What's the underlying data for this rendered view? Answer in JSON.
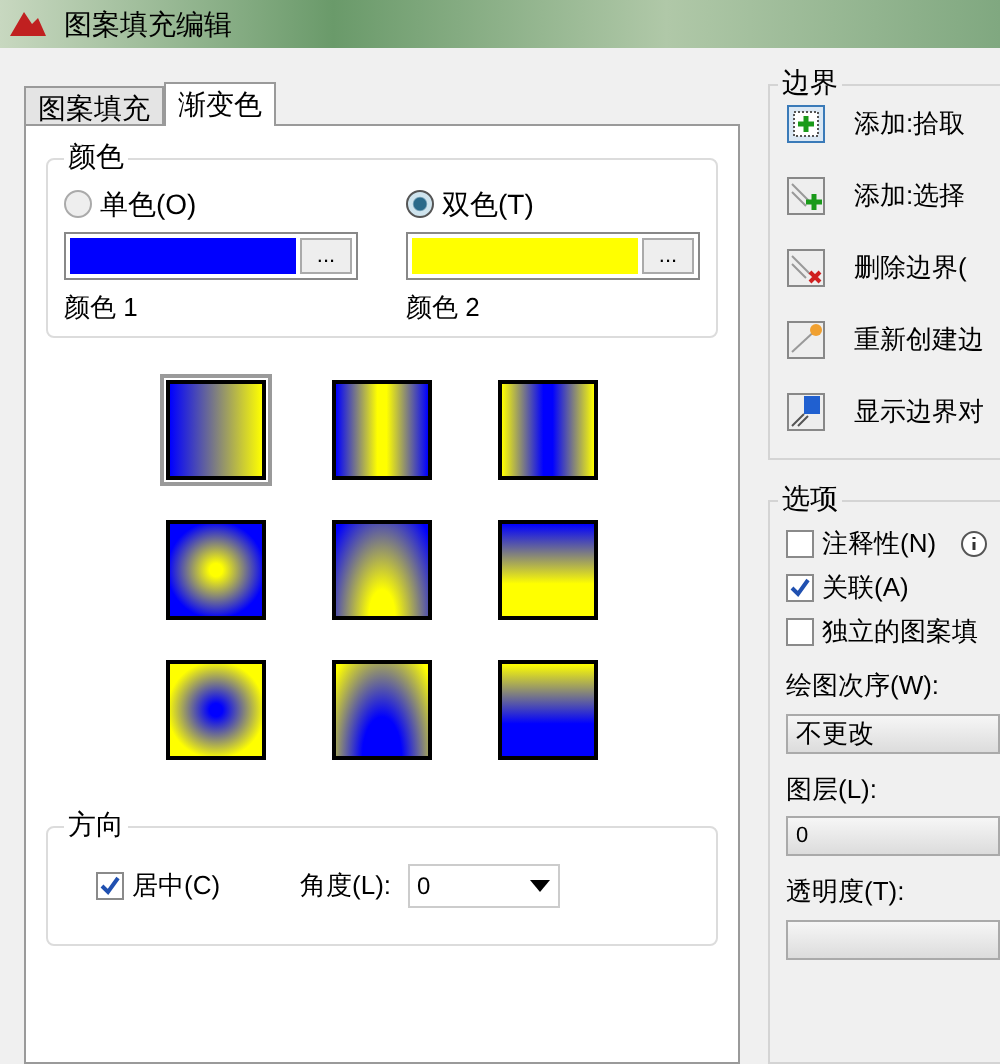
{
  "window": {
    "title": "图案填充编辑"
  },
  "tabs": [
    {
      "label": "图案填充",
      "selected": false
    },
    {
      "label": "渐变色",
      "selected": true
    }
  ],
  "color_group": {
    "title": "颜色",
    "options": [
      {
        "label": "单色(O)",
        "selected": false,
        "color": "#0000ff",
        "caption": "颜色 1",
        "button": "..."
      },
      {
        "label": "双色(T)",
        "selected": true,
        "color": "#ffff00",
        "caption": "颜色 2",
        "button": "..."
      }
    ]
  },
  "gradients": [
    {
      "kind": "linear",
      "selected": true
    },
    {
      "kind": "cylinder",
      "selected": false
    },
    {
      "kind": "inv-cylinder",
      "selected": false
    },
    {
      "kind": "spherical",
      "selected": false
    },
    {
      "kind": "hemispherical",
      "selected": false
    },
    {
      "kind": "curved",
      "selected": false
    },
    {
      "kind": "inv-spherical",
      "selected": false
    },
    {
      "kind": "inv-hemispherical",
      "selected": false
    },
    {
      "kind": "inv-curved",
      "selected": false
    }
  ],
  "orientation": {
    "title": "方向",
    "centered": {
      "label": "居中(C)",
      "checked": true
    },
    "angle": {
      "label": "角度(L):",
      "value": "0"
    }
  },
  "boundaries": {
    "title": "边界",
    "items": [
      {
        "kind": "pick",
        "label": "添加:拾取"
      },
      {
        "kind": "select",
        "label": "添加:选择"
      },
      {
        "kind": "remove",
        "label": "删除边界("
      },
      {
        "kind": "recreate",
        "label": "重新创建边"
      },
      {
        "kind": "view",
        "label": "显示边界对"
      }
    ]
  },
  "options": {
    "title": "选项",
    "checks": [
      {
        "label": "注释性(N)",
        "checked": false,
        "info": true
      },
      {
        "label": "关联(A)",
        "checked": true
      },
      {
        "label": "独立的图案填",
        "checked": false
      }
    ],
    "draw_order": {
      "label": "绘图次序(W):",
      "value": "不更改"
    },
    "layer": {
      "label": "图层(L):",
      "value": "0"
    },
    "transparency": {
      "label": "透明度(T):"
    }
  }
}
